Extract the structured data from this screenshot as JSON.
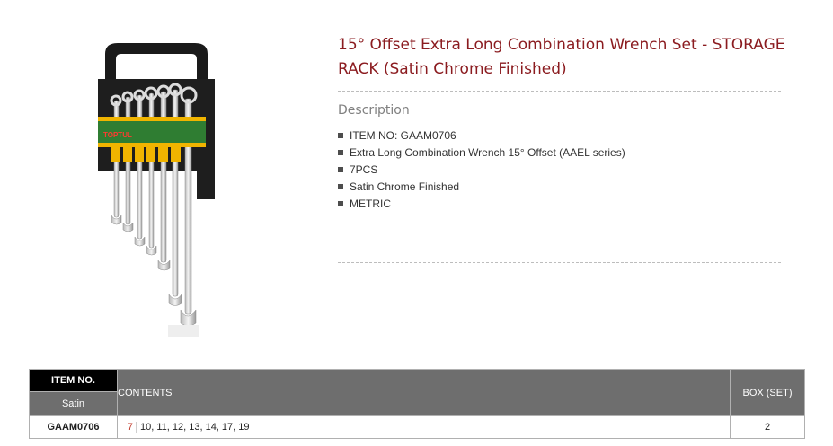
{
  "product": {
    "image_alt": "wrench-set-storage-rack",
    "brand_label": "TOPTUL",
    "title": "15° Offset Extra Long Combination Wrench Set - STORAGE RACK (Satin Chrome Finished)"
  },
  "description": {
    "heading": "Description",
    "items": [
      {
        "label": "ITEM NO: GAAM0706"
      },
      {
        "label": "Extra Long Combination Wrench 15° Offset (AAEL series)"
      },
      {
        "label": "7PCS"
      },
      {
        "label": "Satin Chrome Finished"
      },
      {
        "label": "METRIC"
      }
    ]
  },
  "spec_table": {
    "headers": {
      "item_no": "ITEM NO.",
      "finish": "Satin",
      "contents": "CONTENTS",
      "box": "BOX (SET)"
    },
    "rows": [
      {
        "code": "GAAM0706",
        "qty": "7",
        "sizes": "10, 11, 12, 13, 14, 17, 19",
        "box": "2"
      }
    ]
  },
  "colors": {
    "title": "#8b1c20",
    "header_dark": "#000000",
    "header_grey": "#6e6e6e",
    "qty": "#c0392b"
  }
}
